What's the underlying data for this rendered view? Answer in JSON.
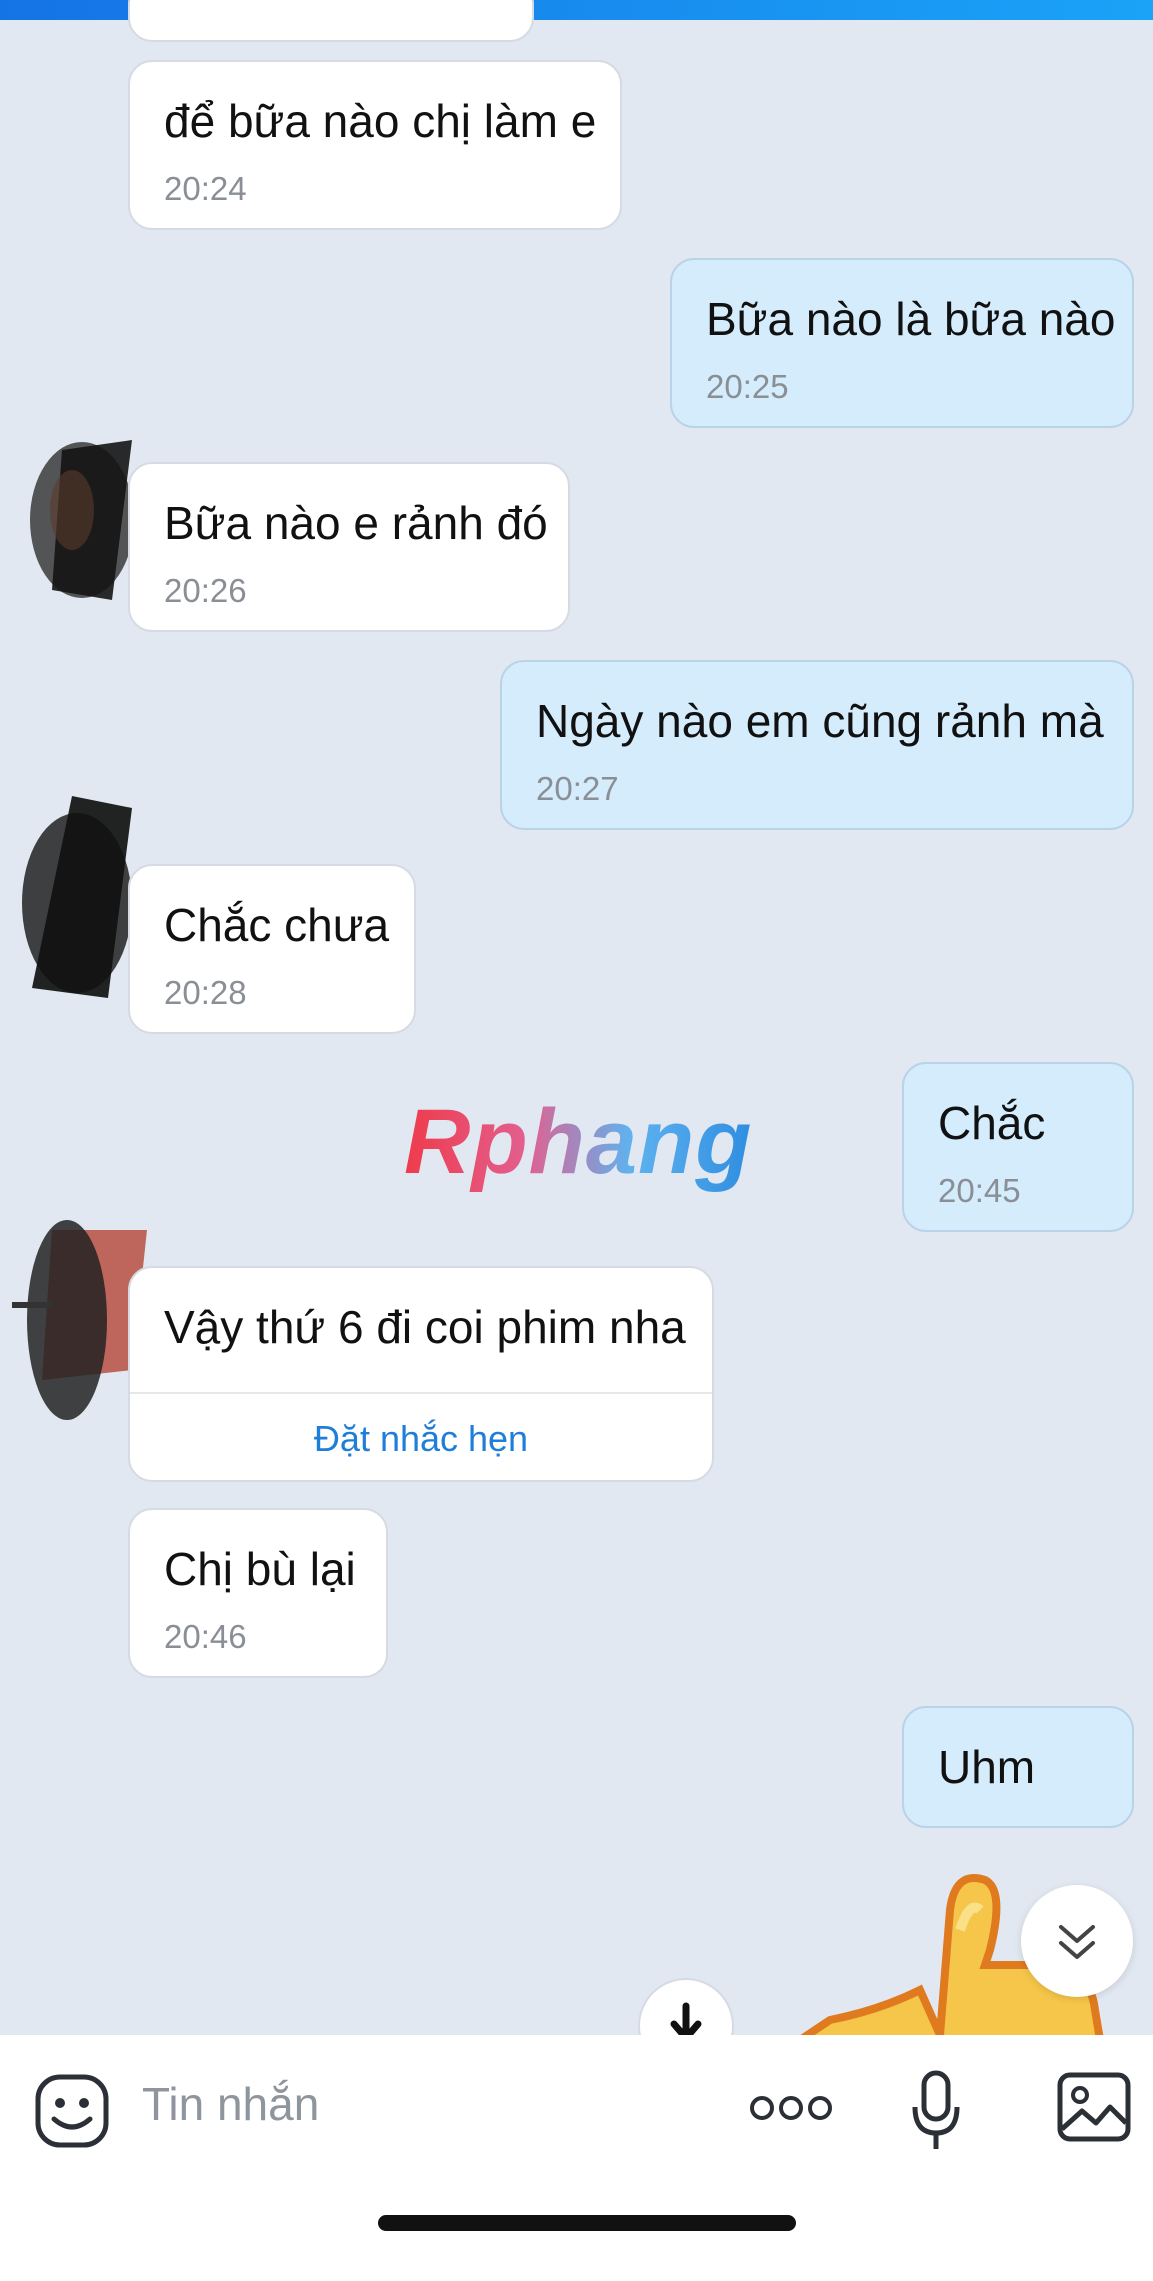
{
  "messages": [
    {
      "side": "in",
      "text": "để bữa nào chị làm e",
      "time": "20:24"
    },
    {
      "side": "out",
      "text": "Bữa nào là bữa nào",
      "time": "20:25"
    },
    {
      "side": "in",
      "text": "Bữa nào e rảnh đó",
      "time": "20:26"
    },
    {
      "side": "out",
      "text": "Ngày nào em cũng rảnh mà",
      "time": "20:27"
    },
    {
      "side": "in",
      "text": "Chắc chưa",
      "time": "20:28"
    },
    {
      "side": "out",
      "text": "Chắc",
      "time": "20:45"
    },
    {
      "side": "in",
      "text": "Vậy thứ 6 đi coi phim nha",
      "action": "Đặt nhắc hẹn"
    },
    {
      "side": "in",
      "text": "Chị bù lại",
      "time": "20:46"
    },
    {
      "side": "out",
      "text": "Uhm"
    }
  ],
  "watermark": "Rphang",
  "composer": {
    "placeholder": "Tin nhắn",
    "icons": [
      "sticker-icon",
      "more-icon",
      "microphone-icon",
      "image-icon"
    ]
  },
  "colors": {
    "background": "#e2e8f1",
    "incoming": "#ffffff",
    "outgoing": "#d4ecfc",
    "link": "#1e7ed8"
  }
}
